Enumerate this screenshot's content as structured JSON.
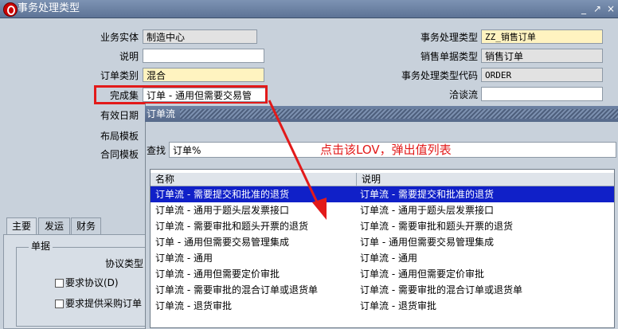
{
  "window": {
    "title": "事务处理类型",
    "min": "_",
    "max": "↗",
    "close": "×"
  },
  "form": {
    "operating_unit": {
      "label": "业务实体",
      "value": "制造中心"
    },
    "description": {
      "label": "说明",
      "value": ""
    },
    "order_category": {
      "label": "订单类别",
      "value": "混合"
    },
    "fulfillment_set": {
      "label": "完成集",
      "value": "订单 - 通用但需要交易管"
    },
    "effective_date": {
      "label": "有效日期"
    },
    "layout_template": {
      "label": "布局模板"
    },
    "contract_template": {
      "label": "合同模板"
    },
    "transaction_type": {
      "label": "事务处理类型",
      "value": "ZZ_销售订单"
    },
    "sales_doc_type": {
      "label": "销售单据类型",
      "value": "销售订单"
    },
    "transaction_type_code": {
      "label": "事务处理类型代码",
      "value": "ORDER"
    },
    "negotiation_flow": {
      "label": "洽谈流",
      "value": ""
    }
  },
  "tabs": [
    {
      "label": "主要"
    },
    {
      "label": "发运"
    },
    {
      "label": "财务"
    }
  ],
  "tab_main": {
    "group_label": "单据",
    "agreement_type_label": "协议类型",
    "require_agreement": "要求协议(D)",
    "require_po": "要求提供采购订单"
  },
  "lov": {
    "title": "订单流",
    "find_label": "查找",
    "find_value": "订单%",
    "columns": [
      "名称",
      "说明"
    ],
    "rows": [
      {
        "name": "订单流 - 需要提交和批准的退货",
        "desc": "订单流 - 需要提交和批准的退货",
        "selected": true
      },
      {
        "name": "订单流 - 通用于题头层发票接口",
        "desc": "订单流 - 通用于题头层发票接口"
      },
      {
        "name": "订单流 - 需要审批和题头开票的退货",
        "desc": "订单流 - 需要审批和题头开票的退货"
      },
      {
        "name": "订单 - 通用但需要交易管理集成",
        "desc": "订单 - 通用但需要交易管理集成"
      },
      {
        "name": "订单流 - 通用",
        "desc": "订单流 - 通用"
      },
      {
        "name": "订单流 - 通用但需要定价审批",
        "desc": "订单流 - 通用但需要定价审批"
      },
      {
        "name": "订单流 - 需要审批的混合订单或退货单",
        "desc": "订单流 - 需要审批的混合订单或退货单"
      },
      {
        "name": "订单流 - 退货审批",
        "desc": "订单流 - 退货审批"
      }
    ]
  },
  "annotation": {
    "text": "点击该LOV，弹出值列表",
    "color": "#e21a1a"
  },
  "colors": {
    "titlebar": "#6d82a3",
    "form_bg": "#c8d1db",
    "selected_row": "#1020c8",
    "required_field": "#fff3c0"
  }
}
